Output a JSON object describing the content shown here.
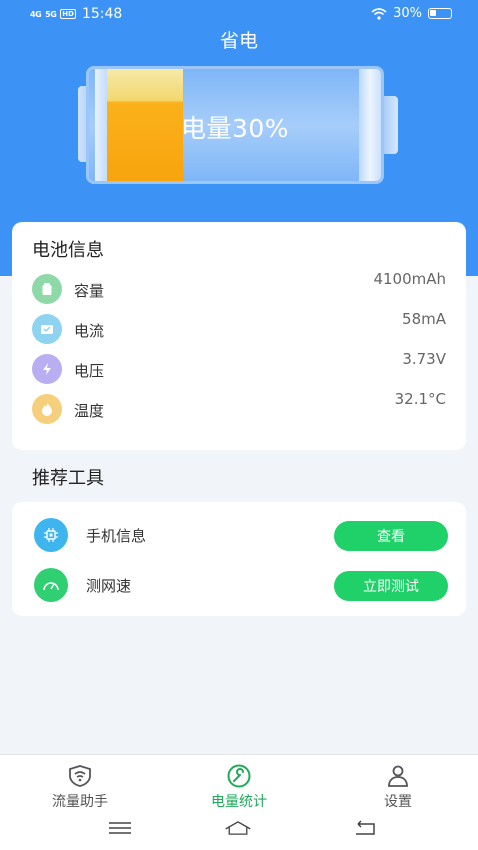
{
  "status_bar": {
    "signal_1": "4G",
    "signal_2": "5G",
    "hd": "HD",
    "time": "15:48",
    "battery_percent": "30%"
  },
  "header": {
    "title": "省电"
  },
  "battery_graphic": {
    "label": "电量30%",
    "level_fraction": 0.3
  },
  "battery_info": {
    "title": "电池信息",
    "items": [
      {
        "label": "容量",
        "value": "4100mAh",
        "icon": "capacity-icon",
        "color": "#8fd9a8"
      },
      {
        "label": "电流",
        "value": "58mA",
        "icon": "current-icon",
        "color": "#8ed3f0"
      },
      {
        "label": "电压",
        "value": "3.73V",
        "icon": "voltage-icon",
        "color": "#b9aef2"
      },
      {
        "label": "温度",
        "value": "32.1°C",
        "icon": "temperature-icon",
        "color": "#f6cf7c"
      }
    ]
  },
  "tools": {
    "title": "推荐工具",
    "items": [
      {
        "label": "手机信息",
        "button": "查看",
        "icon": "chip-icon",
        "color": "#3fb5ef"
      },
      {
        "label": "测网速",
        "button": "立即测试",
        "icon": "speedometer-icon",
        "color": "#2fcf72"
      }
    ]
  },
  "tabbar": {
    "tabs": [
      {
        "label": "流量助手",
        "active": false
      },
      {
        "label": "电量统计",
        "active": true
      },
      {
        "label": "设置",
        "active": false
      }
    ],
    "active_color": "#1faa59",
    "inactive_color": "#555555"
  },
  "colors": {
    "primary_blue": "#3c92f5",
    "button_green": "#1fd168"
  }
}
